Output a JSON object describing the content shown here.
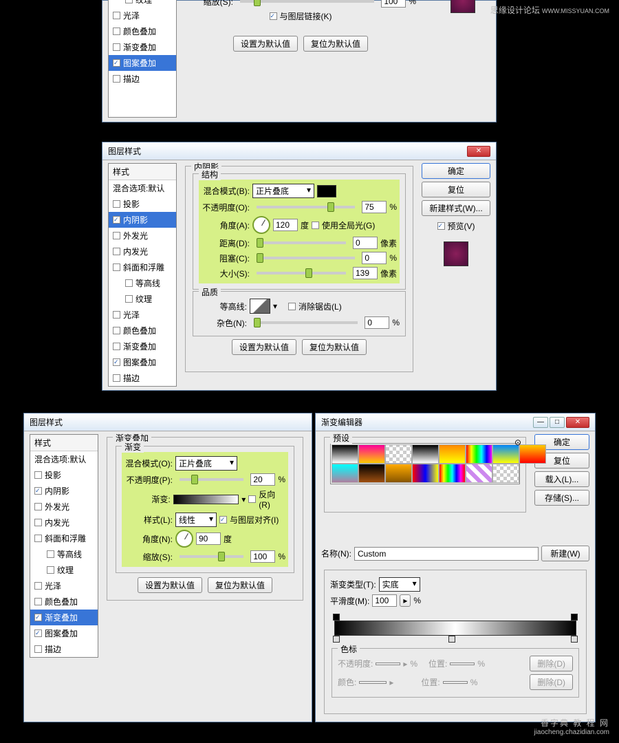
{
  "watermarks": {
    "top": "思缘设计论坛",
    "top_url": "WWW.MISSYUAN.COM",
    "bottom": "香字典 教 程 网",
    "bottom_url": "jiaocheng.chazidian.com"
  },
  "dlg_title": "图层样式",
  "sidebar": {
    "header": "样式",
    "blending": "混合选项:默认",
    "items": [
      {
        "label": "投影",
        "checked": false,
        "indent": false,
        "selected": false
      },
      {
        "label": "内阴影",
        "checked": true,
        "indent": false,
        "selected": true
      },
      {
        "label": "外发光",
        "checked": false,
        "indent": false,
        "selected": false
      },
      {
        "label": "内发光",
        "checked": false,
        "indent": false,
        "selected": false
      },
      {
        "label": "斜面和浮雕",
        "checked": false,
        "indent": false,
        "selected": false
      },
      {
        "label": "等高线",
        "checked": false,
        "indent": true,
        "selected": false
      },
      {
        "label": "纹理",
        "checked": false,
        "indent": true,
        "selected": false
      },
      {
        "label": "光泽",
        "checked": false,
        "indent": false,
        "selected": false
      },
      {
        "label": "颜色叠加",
        "checked": false,
        "indent": false,
        "selected": false
      },
      {
        "label": "渐变叠加",
        "checked": false,
        "indent": false,
        "selected": false
      },
      {
        "label": "图案叠加",
        "checked": true,
        "indent": false,
        "selected": true
      },
      {
        "label": "描边",
        "checked": false,
        "indent": false,
        "selected": false
      }
    ]
  },
  "buttons": {
    "ok": "确定",
    "cancel": "复位",
    "new_style": "新建样式(W)...",
    "preview": "预览(V)",
    "set_default": "设置为默认值",
    "reset_default": "复位为默认值",
    "load": "载入(L)...",
    "save": "存储(S)...",
    "new": "新建(W)",
    "delete": "删除(D)"
  },
  "top_panel": {
    "scale_label": "缩放(S):",
    "scale_val": "100",
    "pct": "%",
    "link_label": "与图层链接(K)"
  },
  "inner_shadow": {
    "title": "内阴影",
    "structure": "结构",
    "quality": "品质",
    "blend_label": "混合模式(B):",
    "blend_val": "正片叠底",
    "opacity_label": "不透明度(O):",
    "opacity_val": "75",
    "angle_label": "角度(A):",
    "angle_val": "120",
    "deg": "度",
    "global_light": "使用全局光(G)",
    "distance_label": "距离(D):",
    "distance_val": "0",
    "px": "像素",
    "choke_label": "阻塞(C):",
    "choke_val": "0",
    "size_label": "大小(S):",
    "size_val": "139",
    "contour_label": "等高线:",
    "antialias": "消除锯齿(L)",
    "noise_label": "杂色(N):",
    "noise_val": "0"
  },
  "gradient_overlay": {
    "title": "渐变叠加",
    "gradient": "渐变",
    "blend_label": "混合模式(O):",
    "blend_val": "正片叠底",
    "opacity_label": "不透明度(P):",
    "opacity_val": "20",
    "gradient_label": "渐变:",
    "reverse": "反向(R)",
    "style_label": "样式(L):",
    "style_val": "线性",
    "align": "与图层对齐(I)",
    "angle_label": "角度(N):",
    "angle_val": "90",
    "deg": "度",
    "scale_label": "缩放(S):",
    "scale_val": "100"
  },
  "gradient_editor": {
    "title": "渐变编辑器",
    "presets": "预设",
    "name_label": "名称(N):",
    "name_val": "Custom",
    "type_label": "渐变类型(T):",
    "type_val": "实底",
    "smooth_label": "平滑度(M):",
    "smooth_val": "100",
    "stops": "色标",
    "opacity_label": "不透明度:",
    "location_label": "位置:",
    "color_label": "颜色:"
  },
  "sidebar3_selected": "渐变叠加",
  "sidebar3_pattern_checked": true
}
